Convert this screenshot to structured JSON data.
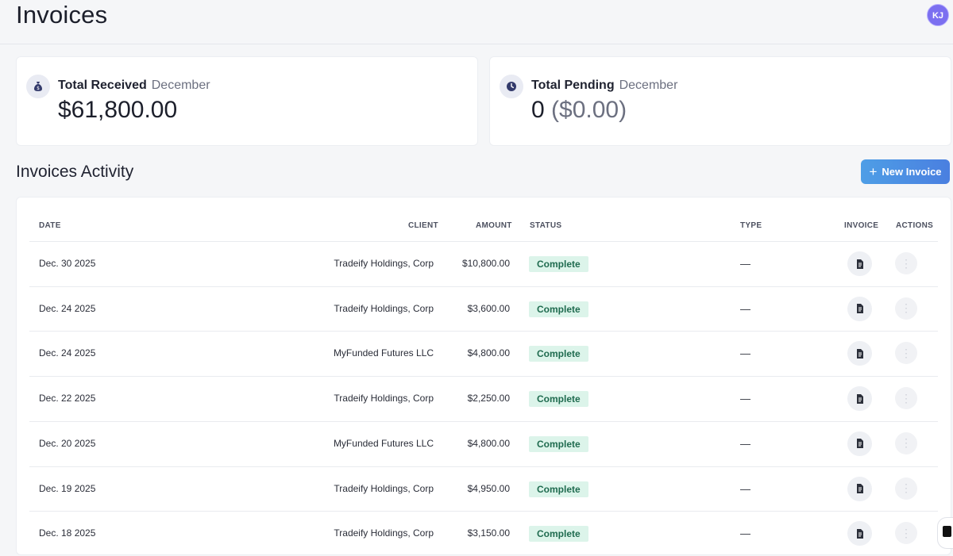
{
  "header": {
    "title": "Invoices",
    "avatar_initials": "KJ"
  },
  "cards": [
    {
      "label": "Total Received",
      "period": "December",
      "value": "$61,800.00",
      "value_suffix": "",
      "icon": "money-bag-icon"
    },
    {
      "label": "Total Pending",
      "period": "December",
      "value": "0",
      "value_suffix": "($0.00)",
      "icon": "clock-icon"
    }
  ],
  "activity": {
    "title": "Invoices Activity",
    "new_button": "New Invoice",
    "columns": [
      "DATE",
      "CLIENT",
      "AMOUNT",
      "STATUS",
      "TYPE",
      "INVOICE",
      "ACTIONS"
    ],
    "rows": [
      {
        "date": "Dec. 30 2025",
        "client": "Tradeify Holdings, Corp",
        "amount": "$10,800.00",
        "status": "Complete",
        "type": "—"
      },
      {
        "date": "Dec. 24 2025",
        "client": "Tradeify Holdings, Corp",
        "amount": "$3,600.00",
        "status": "Complete",
        "type": "—"
      },
      {
        "date": "Dec. 24 2025",
        "client": "MyFunded Futures LLC",
        "amount": "$4,800.00",
        "status": "Complete",
        "type": "—"
      },
      {
        "date": "Dec. 22 2025",
        "client": "Tradeify Holdings, Corp",
        "amount": "$2,250.00",
        "status": "Complete",
        "type": "—"
      },
      {
        "date": "Dec. 20 2025",
        "client": "MyFunded Futures LLC",
        "amount": "$4,800.00",
        "status": "Complete",
        "type": "—"
      },
      {
        "date": "Dec. 19 2025",
        "client": "Tradeify Holdings, Corp",
        "amount": "$4,950.00",
        "status": "Complete",
        "type": "—"
      },
      {
        "date": "Dec. 18 2025",
        "client": "Tradeify Holdings, Corp",
        "amount": "$3,150.00",
        "status": "Complete",
        "type": "—"
      }
    ]
  },
  "colors": {
    "accent": "#4a7fe0",
    "status_bg": "#dcf4ea",
    "status_text": "#1f6b4f",
    "avatar": "#7b6ff0"
  }
}
